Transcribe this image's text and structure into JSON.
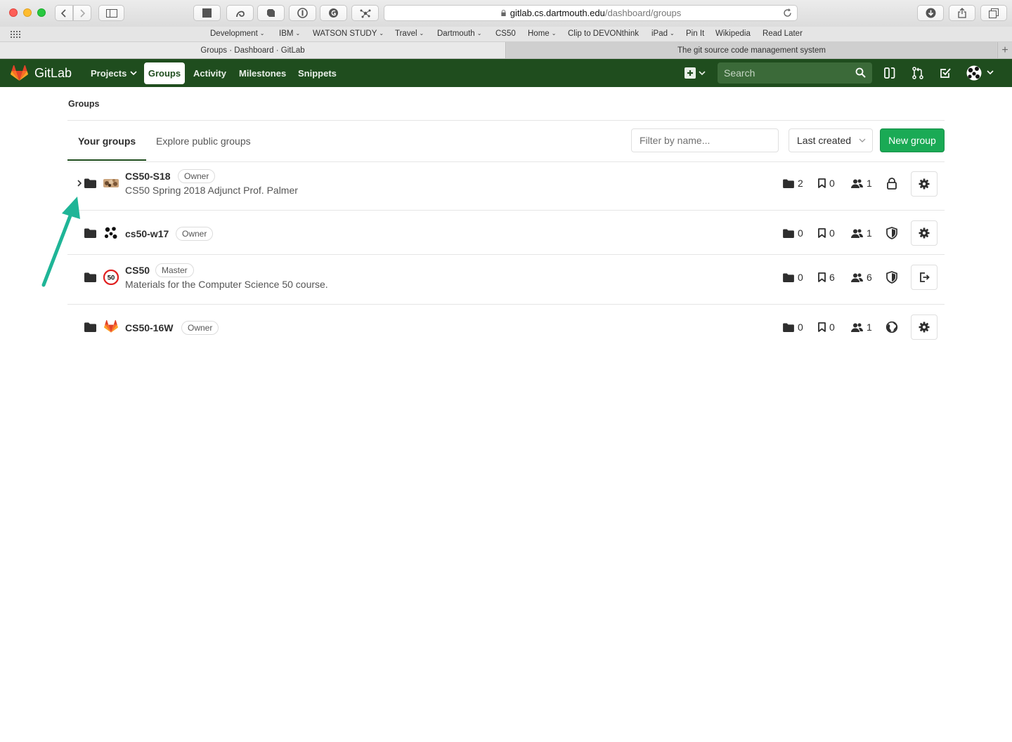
{
  "browser": {
    "url_domain": "gitlab.cs.dartmouth.edu",
    "url_path": "/dashboard/groups",
    "favorites": [
      {
        "label": "Development",
        "dropdown": true
      },
      {
        "label": "IBM",
        "dropdown": true
      },
      {
        "label": "WATSON STUDY",
        "dropdown": true
      },
      {
        "label": "Travel",
        "dropdown": true
      },
      {
        "label": "Dartmouth",
        "dropdown": true
      },
      {
        "label": "CS50",
        "dropdown": false
      },
      {
        "label": "Home",
        "dropdown": true
      },
      {
        "label": "Clip to DEVONthink",
        "dropdown": false
      },
      {
        "label": "iPad",
        "dropdown": true
      },
      {
        "label": "Pin It",
        "dropdown": false
      },
      {
        "label": "Wikipedia",
        "dropdown": false
      },
      {
        "label": "Read Later",
        "dropdown": false
      }
    ],
    "tabs": [
      {
        "title": "Groups · Dashboard · GitLab",
        "active": true
      },
      {
        "title": "The git source code management system",
        "active": false
      }
    ]
  },
  "header": {
    "brand": "GitLab",
    "nav": [
      "Projects",
      "Groups",
      "Activity",
      "Milestones",
      "Snippets"
    ],
    "active_nav": "Groups",
    "search_placeholder": "Search",
    "brand_color": "#1f4d1e"
  },
  "page": {
    "breadcrumb": "Groups",
    "tabs": [
      "Your groups",
      "Explore public groups"
    ],
    "active_tab": "Your groups",
    "filter_placeholder": "Filter by name...",
    "sort_label": "Last created",
    "new_group_label": "New group",
    "accent_color": "#1aaa55"
  },
  "groups": [
    {
      "name": "CS50-S18",
      "role": "Owner",
      "description": "CS50 Spring 2018 Adjunct Prof. Palmer",
      "subgroups": "2",
      "projects": "0",
      "members": "1",
      "visibility": "lock-icon",
      "action": "settings-icon",
      "expandable": true
    },
    {
      "name": "cs50-w17",
      "role": "Owner",
      "description": "",
      "subgroups": "0",
      "projects": "0",
      "members": "1",
      "visibility": "shield-icon",
      "action": "settings-icon",
      "expandable": false
    },
    {
      "name": "CS50",
      "role": "Master",
      "description": "Materials for the Computer Science 50 course.",
      "subgroups": "0",
      "projects": "6",
      "members": "6",
      "visibility": "shield-icon",
      "action": "leave-icon",
      "expandable": false
    },
    {
      "name": "CS50-16W",
      "role": "Owner",
      "description": "",
      "subgroups": "0",
      "projects": "0",
      "members": "1",
      "visibility": "globe-icon",
      "action": "settings-icon",
      "expandable": false
    }
  ],
  "annotation": {
    "arrow_color": "#1fb597"
  }
}
